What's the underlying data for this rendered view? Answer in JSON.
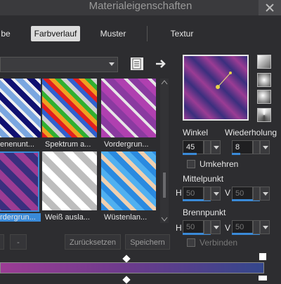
{
  "window": {
    "title": "Materialeigenschaften"
  },
  "tabs": [
    {
      "label": "be",
      "active": false
    },
    {
      "label": "Farbverlauf",
      "active": true
    },
    {
      "label": "Muster",
      "active": false
    },
    {
      "label": "Textur",
      "active": false
    }
  ],
  "swatches": [
    {
      "label": "enenunt...",
      "selected": false
    },
    {
      "label": "Spektrum a...",
      "selected": false
    },
    {
      "label": "Vordergrun...",
      "selected": false
    },
    {
      "label": "rdergrun...",
      "selected": true
    },
    {
      "label": "Weiß ausla...",
      "selected": false
    },
    {
      "label": "Wüstenlan...",
      "selected": false
    }
  ],
  "actions": {
    "minus_label": "-",
    "reset_label": "Zurücksetzen",
    "save_label": "Speichern"
  },
  "settings": {
    "angle_label": "Winkel",
    "angle_value": "45",
    "repeat_label": "Wiederholung",
    "repeat_value": "8",
    "invert_label": "Umkehren",
    "center_label": "Mittelpunkt",
    "center_h_prefix": "H",
    "center_h_value": "50",
    "center_v_prefix": "V",
    "center_v_value": "50",
    "focal_label": "Brennpunkt",
    "focal_h_prefix": "H",
    "focal_h_value": "50",
    "focal_v_prefix": "V",
    "focal_v_value": "50",
    "link_label": "Verbinden"
  },
  "colors": {
    "accent": "#3a8ad8",
    "gradient_start": "#9b3c94",
    "gradient_end": "#34478c"
  }
}
